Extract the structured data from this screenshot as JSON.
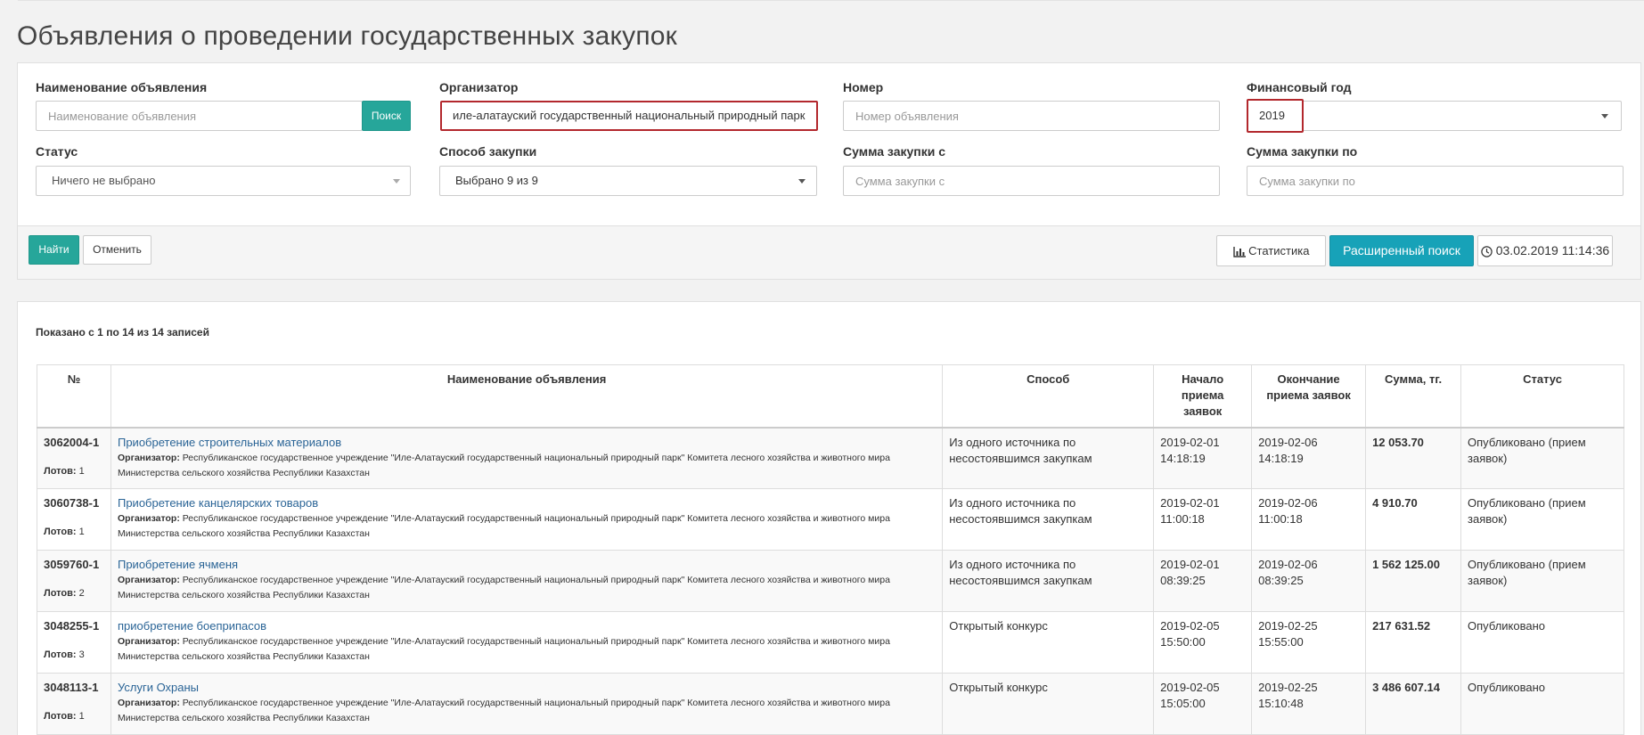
{
  "page_title": "Объявления о проведении государственных закупок",
  "filters": {
    "name_label": "Наименование объявления",
    "name_placeholder": "Наименование объявления",
    "search_button": "Поиск",
    "organizer_label": "Организатор",
    "organizer_value": "иле-алатауский государственный национальный природный парк",
    "number_label": "Номер",
    "number_placeholder": "Номер объявления",
    "year_label": "Финансовый год",
    "year_value": "2019",
    "status_label": "Статус",
    "status_value": "Ничего не выбрано",
    "method_label": "Способ закупки",
    "method_value": "Выбрано 9 из 9",
    "sum_from_label": "Сумма закупки с",
    "sum_from_placeholder": "Сумма закупки с",
    "sum_to_label": "Сумма закупки по",
    "sum_to_placeholder": "Сумма закупки по"
  },
  "actions": {
    "find": "Найти",
    "cancel": "Отменить",
    "stats": "Статистика",
    "advanced": "Расширенный поиск",
    "datetime": "03.02.2019 11:14:36"
  },
  "results": {
    "info": "Показано с 1 по 14 из 14 записей",
    "columns": {
      "num": "№",
      "name": "Наименование объявления",
      "method": "Способ",
      "start": "Начало приема заявок",
      "end": "Окончание приема заявок",
      "sum": "Сумма, тг.",
      "status": "Статус"
    },
    "org_label": "Организатор:",
    "lots_label": "Лотов:",
    "rows": [
      {
        "num": "3062004-1",
        "lots": "1",
        "title": "Приобретение строительных материалов",
        "org": "Республиканское государственное учреждение \"Иле-Алатауский государственный национальный природный парк\" Комитета лесного хозяйства и животного мира Министерства сельского хозяйства Республики Казахстан",
        "method": "Из одного источника по несостоявшимся закупкам",
        "start": "2019-02-01 14:18:19",
        "end": "2019-02-06 14:18:19",
        "sum": "12 053.70",
        "status": "Опубликовано (прием заявок)"
      },
      {
        "num": "3060738-1",
        "lots": "1",
        "title": "Приобретение канцелярских товаров",
        "org": "Республиканское государственное учреждение \"Иле-Алатауский государственный национальный природный парк\" Комитета лесного хозяйства и животного мира Министерства сельского хозяйства Республики Казахстан",
        "method": "Из одного источника по несостоявшимся закупкам",
        "start": "2019-02-01 11:00:18",
        "end": "2019-02-06 11:00:18",
        "sum": "4 910.70",
        "status": "Опубликовано (прием заявок)"
      },
      {
        "num": "3059760-1",
        "lots": "2",
        "title": "Приобретение ячменя",
        "org": "Республиканское государственное учреждение \"Иле-Алатауский государственный национальный природный парк\" Комитета лесного хозяйства и животного мира Министерства сельского хозяйства Республики Казахстан",
        "method": "Из одного источника по несостоявшимся закупкам",
        "start": "2019-02-01 08:39:25",
        "end": "2019-02-06 08:39:25",
        "sum": "1 562 125.00",
        "status": "Опубликовано (прием заявок)"
      },
      {
        "num": "3048255-1",
        "lots": "3",
        "title": "приобретение боеприпасов",
        "org": "Республиканское государственное учреждение \"Иле-Алатауский государственный национальный природный парк\" Комитета лесного хозяйства и животного мира Министерства сельского хозяйства Республики Казахстан",
        "method": "Открытый конкурс",
        "start": "2019-02-05 15:50:00",
        "end": "2019-02-25 15:55:00",
        "sum": "217 631.52",
        "status": "Опубликовано"
      },
      {
        "num": "3048113-1",
        "lots": "1",
        "title": "Услуги Охраны",
        "org": "Республиканское государственное учреждение \"Иле-Алатауский государственный национальный природный парк\" Комитета лесного хозяйства и животного мира Министерства сельского хозяйства Республики Казахстан",
        "method": "Открытый конкурс",
        "start": "2019-02-05 15:05:00",
        "end": "2019-02-25 15:10:48",
        "sum": "3 486 607.14",
        "status": "Опубликовано"
      }
    ]
  }
}
